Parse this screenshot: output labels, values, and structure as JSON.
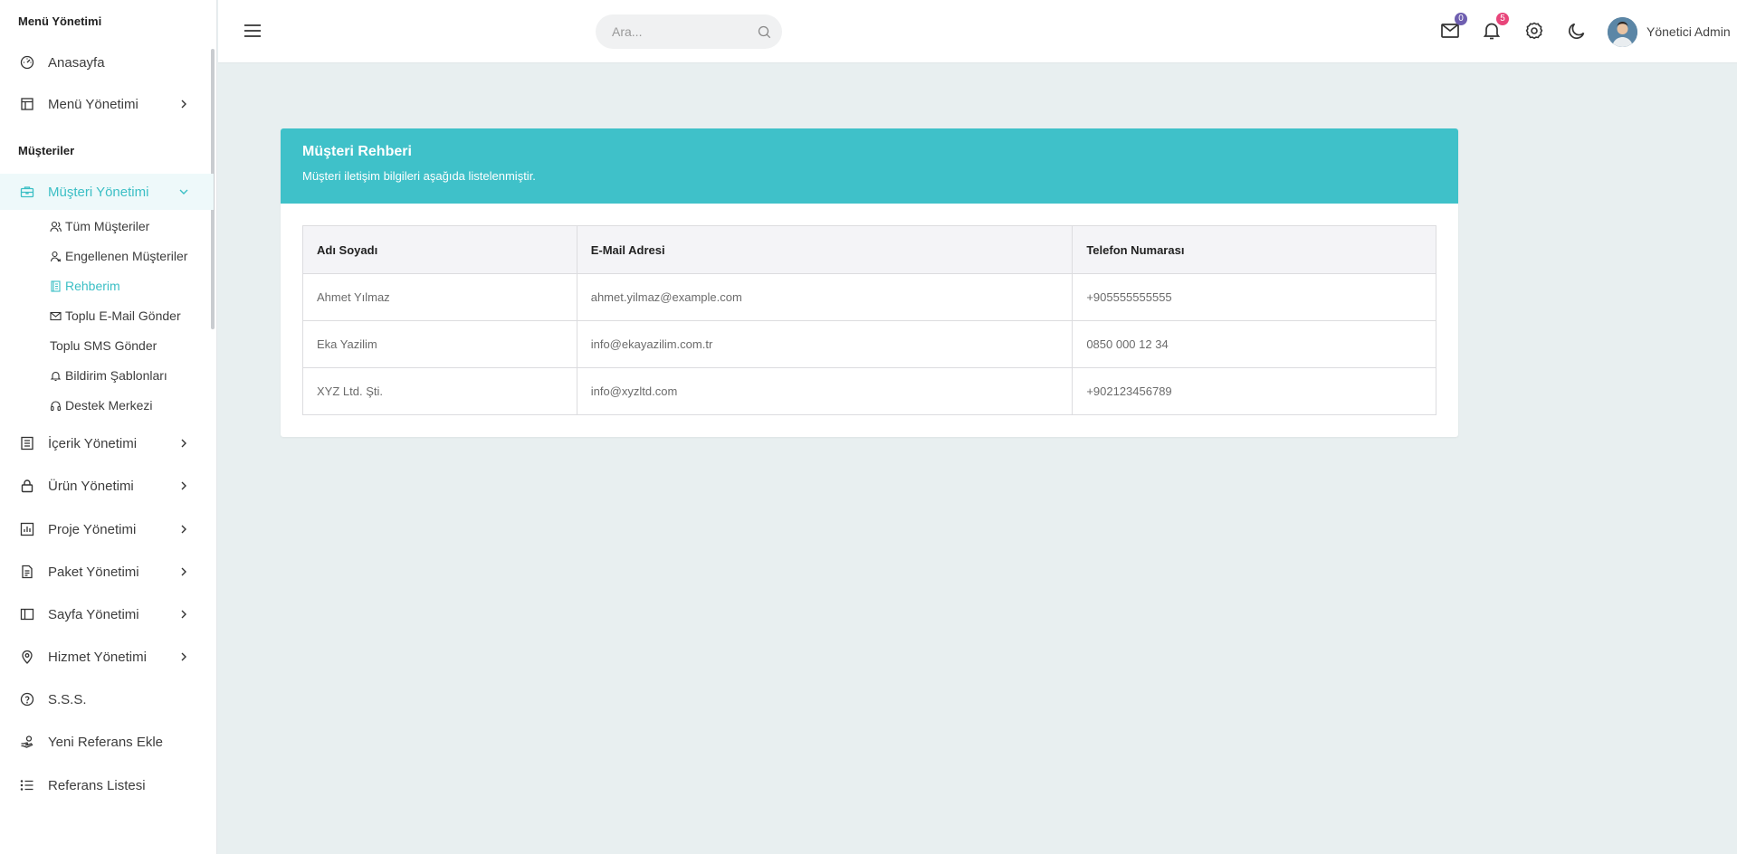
{
  "sidebar": {
    "section1": "Menü Yönetimi",
    "section2": "Müşteriler",
    "items": {
      "home": "Anasayfa",
      "menu": "Menü Yönetimi",
      "customers": "Müşteri Yönetimi",
      "content": "İçerik Yönetimi",
      "products": "Ürün Yönetimi",
      "projects": "Proje Yönetimi",
      "packages": "Paket Yönetimi",
      "pages": "Sayfa Yönetimi",
      "services": "Hizmet Yönetimi",
      "faq": "S.S.S.",
      "new_ref": "Yeni Referans Ekle",
      "ref_list": "Referans Listesi"
    },
    "subitems": {
      "all": "Tüm Müşteriler",
      "blocked": "Engellenen Müşteriler",
      "directory": "Rehberim",
      "bulk_email": "Toplu E-Mail Gönder",
      "bulk_sms": "Toplu SMS Gönder",
      "templates": "Bildirim Şablonları",
      "support": "Destek Merkezi"
    }
  },
  "header": {
    "search_placeholder": "Ara...",
    "mail_count": "0",
    "notif_count": "5",
    "user_name": "Yönetici Admin"
  },
  "card": {
    "title": "Müşteri Rehberi",
    "subtitle": "Müşteri iletişim bilgileri aşağıda listelenmiştir."
  },
  "table": {
    "headers": [
      "Adı Soyadı",
      "E-Mail Adresi",
      "Telefon Numarası"
    ],
    "rows": [
      [
        "Ahmet Yılmaz",
        "ahmet.yilmaz@example.com",
        "+905555555555"
      ],
      [
        "Eka Yazilim",
        "info@ekayazilim.com.tr",
        "0850 000 12 34"
      ],
      [
        "XYZ Ltd. Şti.",
        "info@xyzltd.com",
        "+902123456789"
      ]
    ]
  },
  "colors": {
    "accent": "#3fc1c9",
    "mail_badge": "#6f5fb0",
    "notif_badge": "#e8457a"
  }
}
